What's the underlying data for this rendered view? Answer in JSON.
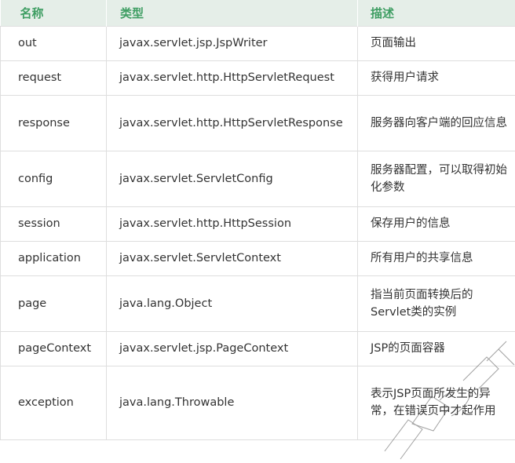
{
  "table": {
    "headers": [
      "名称",
      "类型",
      "描述"
    ],
    "rows": [
      {
        "name": "out",
        "type": "javax.servlet.jsp.JspWriter",
        "desc": "页面输出"
      },
      {
        "name": "request",
        "type": "javax.servlet.http.HttpServletRequest",
        "desc": "获得用户请求"
      },
      {
        "name": "response",
        "type": "javax.servlet.http.HttpServletResponse",
        "desc": "服务器向客户端的回应信息"
      },
      {
        "name": "config",
        "type": "javax.servlet.ServletConfig",
        "desc": "服务器配置，可以取得初始化参数"
      },
      {
        "name": "session",
        "type": "javax.servlet.http.HttpSession",
        "desc": "保存用户的信息"
      },
      {
        "name": "application",
        "type": "javax.servlet.ServletContext",
        "desc": "所有用户的共享信息"
      },
      {
        "name": "page",
        "type": "java.lang.Object",
        "desc": "指当前页面转换后的Servlet类的实例"
      },
      {
        "name": "pageContext",
        "type": "javax.servlet.jsp.PageContext",
        "desc": "JSP的页面容器"
      },
      {
        "name": "exception",
        "type": "java.lang.Throwable",
        "desc": "表示JSP页面所发生的异常，在错误页中才起作用"
      }
    ]
  },
  "colors": {
    "header_bg": "#e5eee8",
    "header_text": "#3f9e63",
    "border": "#dedede"
  }
}
